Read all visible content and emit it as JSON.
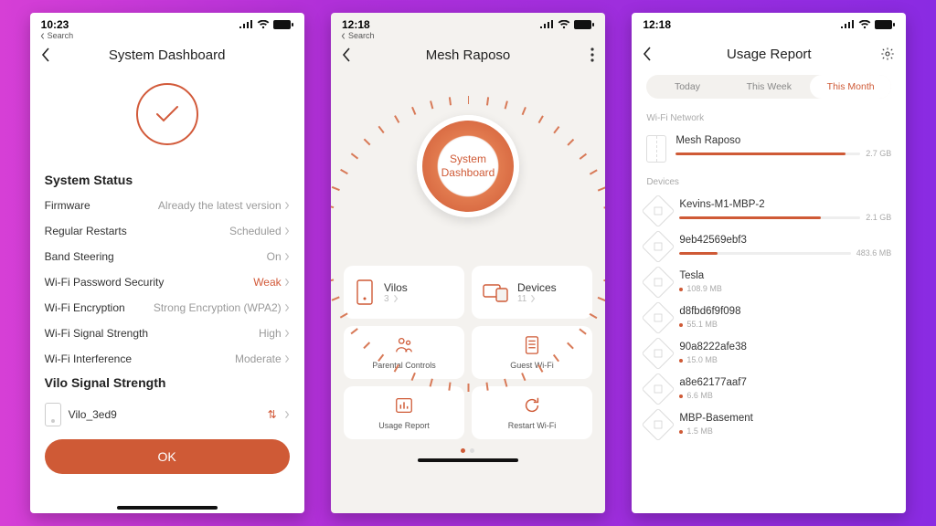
{
  "accent": "#cf5a36",
  "screen1": {
    "status_time": "10:23",
    "breadcrumb": "Search",
    "title": "System Dashboard",
    "section_status": "System Status",
    "rows": [
      {
        "label": "Firmware",
        "value": "Already the latest version",
        "weak": false
      },
      {
        "label": "Regular Restarts",
        "value": "Scheduled",
        "weak": false
      },
      {
        "label": "Band Steering",
        "value": "On",
        "weak": false
      },
      {
        "label": "Wi-Fi Password Security",
        "value": "Weak",
        "weak": true
      },
      {
        "label": "Wi-Fi Encryption",
        "value": "Strong Encryption (WPA2)",
        "weak": false
      },
      {
        "label": "Wi-Fi Signal Strength",
        "value": "High",
        "weak": false
      },
      {
        "label": "Wi-Fi Interference",
        "value": "Moderate",
        "weak": false
      }
    ],
    "signal_title": "Vilo Signal Strength",
    "signal_device": "Vilo_3ed9",
    "ok_label": "OK"
  },
  "screen2": {
    "status_time": "12:18",
    "breadcrumb": "Search",
    "title": "Mesh Raposo",
    "dial_line1": "System",
    "dial_line2": "Dashboard",
    "card_vilos_title": "Vilos",
    "card_vilos_count": "3",
    "card_devices_title": "Devices",
    "card_devices_count": "11",
    "mini": [
      "Parental Controls",
      "Guest Wi-Fi",
      "Usage Report",
      "Restart Wi-Fi"
    ]
  },
  "screen3": {
    "status_time": "12:18",
    "title": "Usage Report",
    "tabs": [
      "Today",
      "This Week",
      "This Month"
    ],
    "active_tab": 2,
    "group_network": "Wi-Fi Network",
    "network": {
      "name": "Mesh Raposo",
      "value": "2.7 GB",
      "pct": 92
    },
    "group_devices": "Devices",
    "devices": [
      {
        "name": "Kevins-M1-MBP-2",
        "value": "2.1 GB",
        "pct": 78,
        "bar": true
      },
      {
        "name": "9eb42569ebf3",
        "value": "483.6 MB",
        "pct": 22,
        "bar": true
      },
      {
        "name": "Tesla",
        "value": "108.9 MB",
        "pct": 0,
        "bar": false
      },
      {
        "name": "d8fbd6f9f098",
        "value": "55.1 MB",
        "pct": 0,
        "bar": false
      },
      {
        "name": "90a8222afe38",
        "value": "15.0 MB",
        "pct": 0,
        "bar": false
      },
      {
        "name": "a8e62177aaf7",
        "value": "6.6 MB",
        "pct": 0,
        "bar": false
      },
      {
        "name": "MBP-Basement",
        "value": "1.5 MB",
        "pct": 0,
        "bar": false
      }
    ]
  }
}
